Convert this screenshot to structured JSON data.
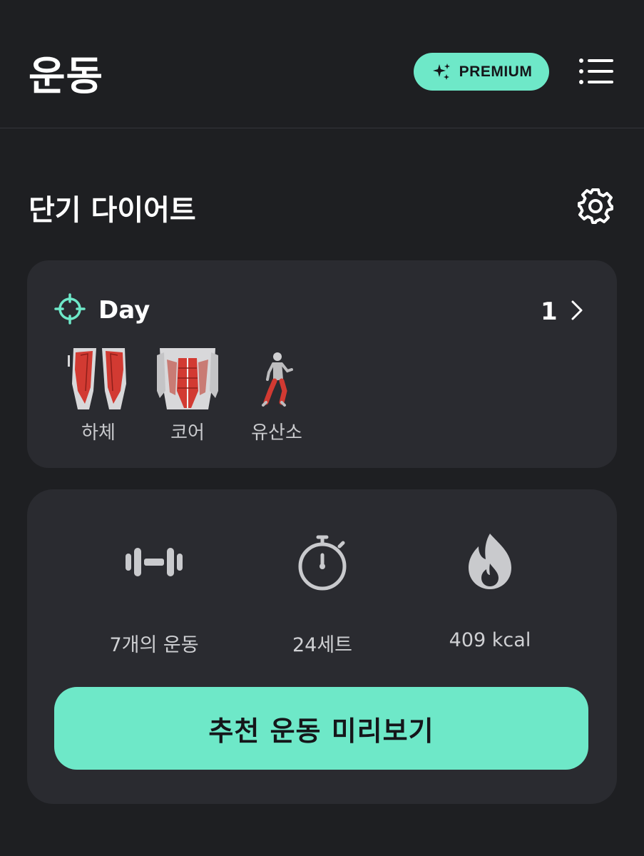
{
  "header": {
    "title": "운동",
    "premium_label": "PREMIUM"
  },
  "plan": {
    "title": "단기 다이어트"
  },
  "day_card": {
    "day_label": "Day",
    "day_number": "1",
    "muscles": [
      {
        "label": "하체"
      },
      {
        "label": "코어"
      },
      {
        "label": "유산소"
      }
    ]
  },
  "summary": {
    "exercises": "7개의 운동",
    "sets": "24세트",
    "calories": "409 kcal",
    "cta_label": "추천 운동 미리보기"
  },
  "colors": {
    "background": "#1e1f22",
    "card": "#2a2b30",
    "accent": "#6ee8c8",
    "icon_gray": "#c9cacd"
  },
  "icons": [
    "sparkle-icon",
    "menu-list-icon",
    "gear-icon",
    "target-icon",
    "chevron-right-icon",
    "dumbbell-icon",
    "stopwatch-icon",
    "flame-icon"
  ]
}
